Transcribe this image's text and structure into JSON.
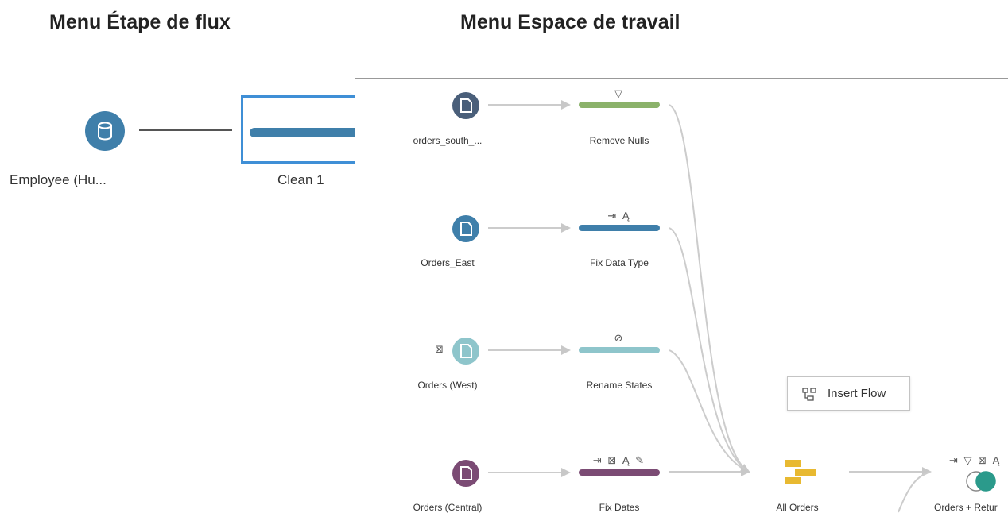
{
  "headings": {
    "left": "Menu Étape de flux",
    "right": "Menu Espace de travail"
  },
  "left_menu": {
    "input_label": "Employee (Hu...",
    "step_label": "Clean 1"
  },
  "workspace": {
    "inputs": [
      {
        "label": "orders_south_...",
        "color": "#4a5f7a"
      },
      {
        "label": "Orders_East",
        "color": "#3f7faa"
      },
      {
        "label": "Orders (West)",
        "color": "#8ec5cb"
      },
      {
        "label": "Orders (Central)",
        "color": "#7b4b74"
      }
    ],
    "steps": [
      {
        "label": "Remove Nulls",
        "color": "#8bb26a",
        "icons": "▽"
      },
      {
        "label": "Fix Data Type",
        "color": "#3f7faa",
        "icons": "⇥ Ą"
      },
      {
        "label": "Rename States",
        "color": "#8ec5cb",
        "icons": "⊘"
      },
      {
        "label": "Fix Dates",
        "color": "#7b4b74",
        "icons": "⇥ ⊠ Ą ✎"
      }
    ],
    "union_label": "All Orders",
    "join_label": "Orders + Retur",
    "join_icons": "⇥ ▽ ⊠ Ą",
    "insert_flow_label": "Insert Flow"
  }
}
